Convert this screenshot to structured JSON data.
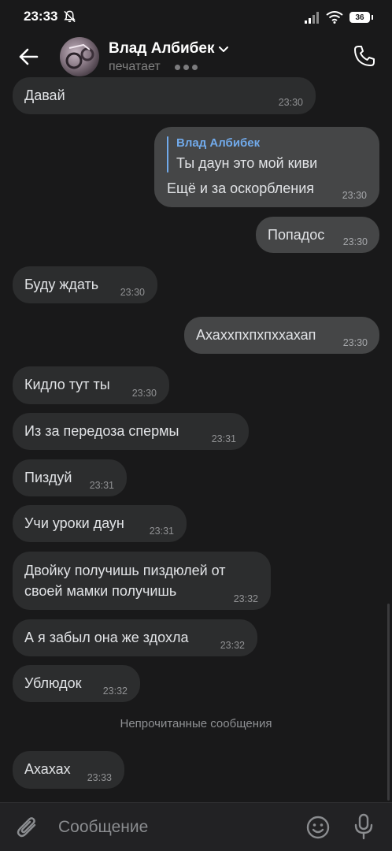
{
  "status_bar": {
    "time": "23:33",
    "battery": "36"
  },
  "header": {
    "contact_name": "Влад Албибек",
    "status": "печатает"
  },
  "messages": [
    {
      "direction": "in",
      "text": "Давай",
      "time": "23:30"
    },
    {
      "direction": "out",
      "reply_author": "Влад Албибек",
      "reply_text": "Ты даун это мой киви",
      "text": "Ещё и за оскорбления",
      "time": "23:30"
    },
    {
      "direction": "out",
      "text": "Попадос",
      "time": "23:30"
    },
    {
      "direction": "in",
      "text": "Буду ждать",
      "time": "23:30"
    },
    {
      "direction": "out",
      "text": "Ахаххпхпхпххахап",
      "time": "23:30"
    },
    {
      "direction": "in",
      "text": "Кидло тут ты",
      "time": "23:30"
    },
    {
      "direction": "in",
      "text": "Из за передоза спермы",
      "time": "23:31"
    },
    {
      "direction": "in",
      "text": "Пиздуй",
      "time": "23:31"
    },
    {
      "direction": "in",
      "text": "Учи уроки даун",
      "time": "23:31"
    },
    {
      "direction": "in",
      "text_line1": "Двойку получишь пиздюлей от",
      "text_line2": "своей мамки получишь",
      "time": "23:32"
    },
    {
      "direction": "in",
      "text": "А я забыл она же здохла",
      "time": "23:32"
    },
    {
      "direction": "in",
      "text": "Ублюдок",
      "time": "23:32"
    },
    {
      "direction": "in",
      "text": "Ахахах",
      "time": "23:33"
    }
  ],
  "unread_divider": "Непрочитанные сообщения",
  "composer": {
    "placeholder": "Сообщение"
  },
  "colors": {
    "background": "#19191a",
    "incoming_bubble": "#2c2d2e",
    "outgoing_bubble": "#454647",
    "accent": "#71aaeb"
  }
}
